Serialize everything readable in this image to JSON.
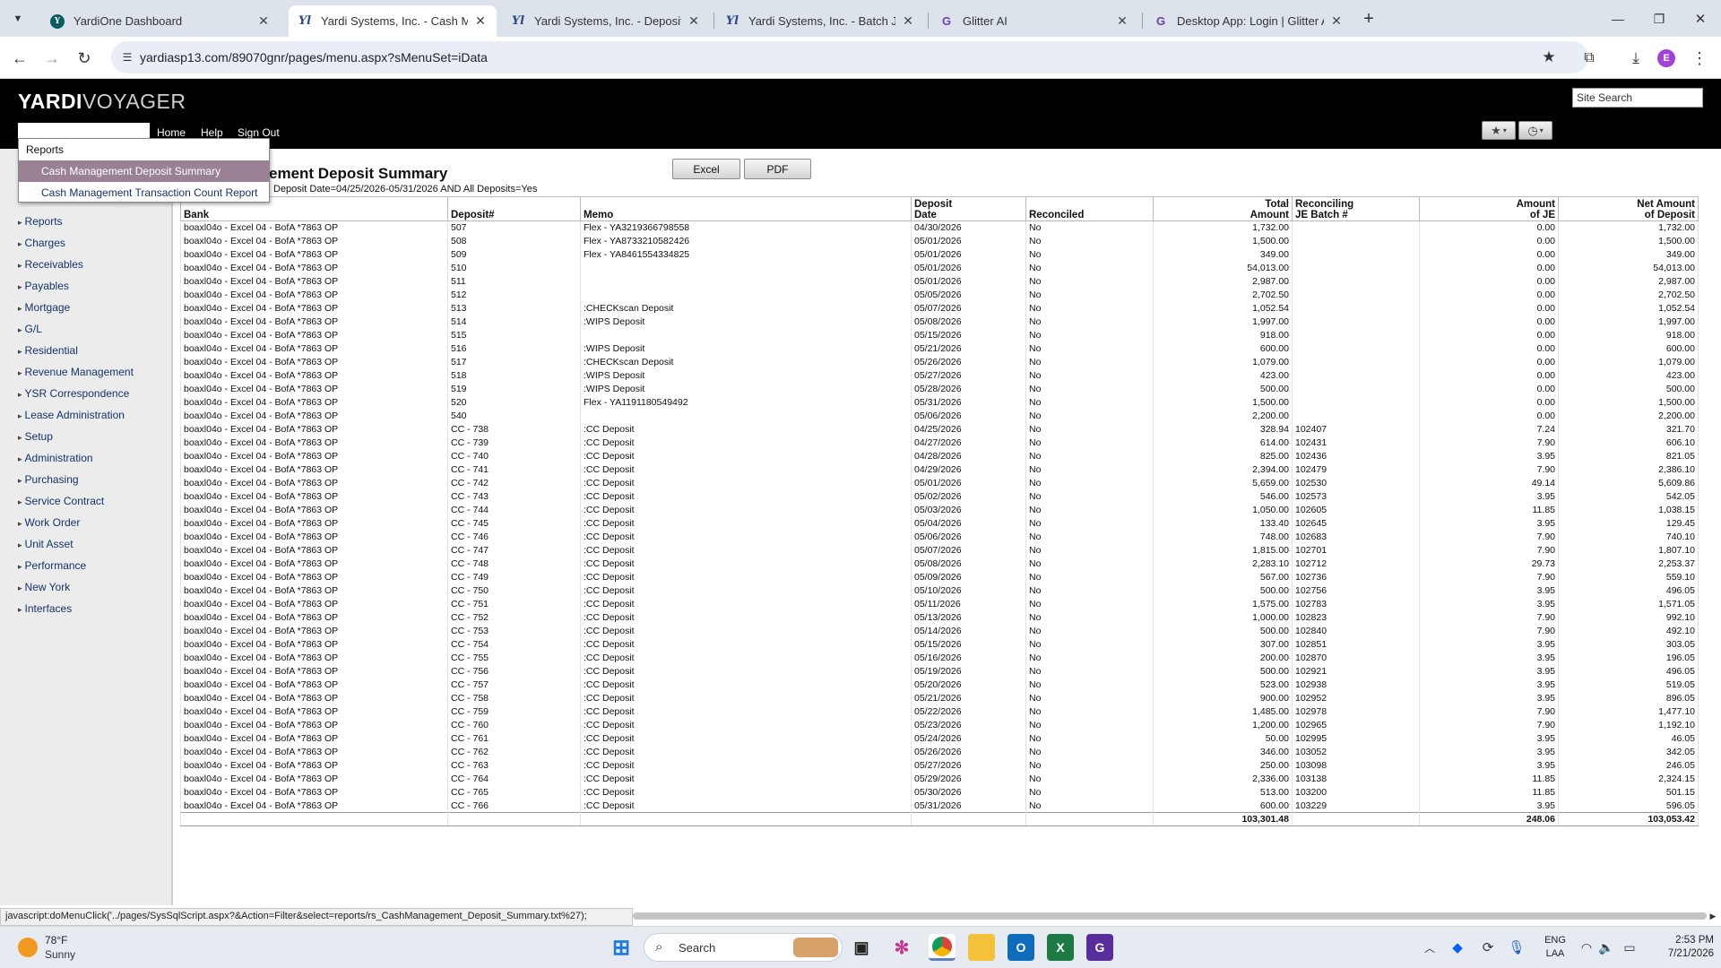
{
  "browser": {
    "tabs": [
      {
        "title": "YardiOne Dashboard",
        "favicon": "yardione-icon"
      },
      {
        "title": "Yardi Systems, Inc. - Cash Mana",
        "favicon": "yardi-icon",
        "active": true
      },
      {
        "title": "Yardi Systems, Inc. - Deposit Re",
        "favicon": "yardi-icon"
      },
      {
        "title": "Yardi Systems, Inc. - Batch Journ",
        "favicon": "yardi-icon"
      },
      {
        "title": "Glitter AI",
        "favicon": "glitter-icon"
      },
      {
        "title": "Desktop App: Login | Glitter AI",
        "favicon": "glitter-icon"
      }
    ],
    "url": "yardiasp13.com/89070gnr/pages/menu.aspx?sMenuSet=iData",
    "profile_initial": "E",
    "profile_color": "#a142d6"
  },
  "app": {
    "logo_bold": "YARDI",
    "logo_light": "VOYAGER",
    "site_search_placeholder": "Site Search",
    "top_nav": [
      "Home",
      "Help",
      "Sign Out"
    ]
  },
  "dropdown": {
    "header": "Reports",
    "items": [
      "Cash Management Deposit Summary",
      "Cash Management Transaction Count Report"
    ],
    "selected_index": 0
  },
  "left_nav": [
    "Reports",
    "Charges",
    "Receivables",
    "Payables",
    "Mortgage",
    "G/L",
    "Residential",
    "Revenue Management",
    "YSR Correspondence",
    "Lease Administration",
    "Setup",
    "Administration",
    "Purchasing",
    "Service Contract",
    "Work Order",
    "Unit Asset",
    "Performance",
    "New York",
    "Interfaces"
  ],
  "report": {
    "title": "ement Deposit Summary",
    "filter": "Deposit Date=04/25/2026-05/31/2026 AND All Deposits=Yes",
    "excel_label": "Excel",
    "pdf_label": "PDF",
    "columns": [
      "Bank",
      "Deposit#",
      "Memo",
      "Deposit Date",
      "Reconciled",
      "Total Amount",
      "Reconciling JE Batch #",
      "Amount of JE",
      "Net Amount of Deposit"
    ],
    "rows": [
      [
        "boaxl04o - Excel 04 - BofA *7863 OP",
        "507",
        "Flex - YA3219366798558",
        "04/30/2026",
        "No",
        "1,732.00",
        "",
        "0.00",
        "1,732.00"
      ],
      [
        "boaxl04o - Excel 04 - BofA *7863 OP",
        "508",
        "Flex - YA8733210582426",
        "05/01/2026",
        "No",
        "1,500.00",
        "",
        "0.00",
        "1,500.00"
      ],
      [
        "boaxl04o - Excel 04 - BofA *7863 OP",
        "509",
        "Flex - YA8461554334825",
        "05/01/2026",
        "No",
        "349.00",
        "",
        "0.00",
        "349.00"
      ],
      [
        "boaxl04o - Excel 04 - BofA *7863 OP",
        "510",
        "",
        "05/01/2026",
        "No",
        "54,013.00",
        "",
        "0.00",
        "54,013.00"
      ],
      [
        "boaxl04o - Excel 04 - BofA *7863 OP",
        "511",
        "",
        "05/01/2026",
        "No",
        "2,987.00",
        "",
        "0.00",
        "2,987.00"
      ],
      [
        "boaxl04o - Excel 04 - BofA *7863 OP",
        "512",
        "",
        "05/05/2026",
        "No",
        "2,702.50",
        "",
        "0.00",
        "2,702.50"
      ],
      [
        "boaxl04o - Excel 04 - BofA *7863 OP",
        "513",
        ":CHECKscan Deposit",
        "05/07/2026",
        "No",
        "1,052.54",
        "",
        "0.00",
        "1,052.54"
      ],
      [
        "boaxl04o - Excel 04 - BofA *7863 OP",
        "514",
        ":WIPS Deposit",
        "05/08/2026",
        "No",
        "1,997.00",
        "",
        "0.00",
        "1,997.00"
      ],
      [
        "boaxl04o - Excel 04 - BofA *7863 OP",
        "515",
        "",
        "05/15/2026",
        "No",
        "918.00",
        "",
        "0.00",
        "918.00"
      ],
      [
        "boaxl04o - Excel 04 - BofA *7863 OP",
        "516",
        ":WIPS Deposit",
        "05/21/2026",
        "No",
        "600.00",
        "",
        "0.00",
        "600.00"
      ],
      [
        "boaxl04o - Excel 04 - BofA *7863 OP",
        "517",
        ":CHECKscan Deposit",
        "05/26/2026",
        "No",
        "1,079.00",
        "",
        "0.00",
        "1,079.00"
      ],
      [
        "boaxl04o - Excel 04 - BofA *7863 OP",
        "518",
        ":WIPS Deposit",
        "05/27/2026",
        "No",
        "423.00",
        "",
        "0.00",
        "423.00"
      ],
      [
        "boaxl04o - Excel 04 - BofA *7863 OP",
        "519",
        ":WIPS Deposit",
        "05/28/2026",
        "No",
        "500.00",
        "",
        "0.00",
        "500.00"
      ],
      [
        "boaxl04o - Excel 04 - BofA *7863 OP",
        "520",
        "Flex - YA1191180549492",
        "05/31/2026",
        "No",
        "1,500.00",
        "",
        "0.00",
        "1,500.00"
      ],
      [
        "boaxl04o - Excel 04 - BofA *7863 OP",
        "540",
        "",
        "05/06/2026",
        "No",
        "2,200.00",
        "",
        "0.00",
        "2,200.00"
      ],
      [
        "boaxl04o - Excel 04 - BofA *7863 OP",
        "CC - 738",
        ":CC Deposit",
        "04/25/2026",
        "No",
        "328.94",
        "102407",
        "7.24",
        "321.70"
      ],
      [
        "boaxl04o - Excel 04 - BofA *7863 OP",
        "CC - 739",
        ":CC Deposit",
        "04/27/2026",
        "No",
        "614.00",
        "102431",
        "7.90",
        "606.10"
      ],
      [
        "boaxl04o - Excel 04 - BofA *7863 OP",
        "CC - 740",
        ":CC Deposit",
        "04/28/2026",
        "No",
        "825.00",
        "102436",
        "3.95",
        "821.05"
      ],
      [
        "boaxl04o - Excel 04 - BofA *7863 OP",
        "CC - 741",
        ":CC Deposit",
        "04/29/2026",
        "No",
        "2,394.00",
        "102479",
        "7.90",
        "2,386.10"
      ],
      [
        "boaxl04o - Excel 04 - BofA *7863 OP",
        "CC - 742",
        ":CC Deposit",
        "05/01/2026",
        "No",
        "5,659.00",
        "102530",
        "49.14",
        "5,609.86"
      ],
      [
        "boaxl04o - Excel 04 - BofA *7863 OP",
        "CC - 743",
        ":CC Deposit",
        "05/02/2026",
        "No",
        "546.00",
        "102573",
        "3.95",
        "542.05"
      ],
      [
        "boaxl04o - Excel 04 - BofA *7863 OP",
        "CC - 744",
        ":CC Deposit",
        "05/03/2026",
        "No",
        "1,050.00",
        "102605",
        "11.85",
        "1,038.15"
      ],
      [
        "boaxl04o - Excel 04 - BofA *7863 OP",
        "CC - 745",
        ":CC Deposit",
        "05/04/2026",
        "No",
        "133.40",
        "102645",
        "3.95",
        "129.45"
      ],
      [
        "boaxl04o - Excel 04 - BofA *7863 OP",
        "CC - 746",
        ":CC Deposit",
        "05/06/2026",
        "No",
        "748.00",
        "102683",
        "7.90",
        "740.10"
      ],
      [
        "boaxl04o - Excel 04 - BofA *7863 OP",
        "CC - 747",
        ":CC Deposit",
        "05/07/2026",
        "No",
        "1,815.00",
        "102701",
        "7.90",
        "1,807.10"
      ],
      [
        "boaxl04o - Excel 04 - BofA *7863 OP",
        "CC - 748",
        ":CC Deposit",
        "05/08/2026",
        "No",
        "2,283.10",
        "102712",
        "29.73",
        "2,253.37"
      ],
      [
        "boaxl04o - Excel 04 - BofA *7863 OP",
        "CC - 749",
        ":CC Deposit",
        "05/09/2026",
        "No",
        "567.00",
        "102736",
        "7.90",
        "559.10"
      ],
      [
        "boaxl04o - Excel 04 - BofA *7863 OP",
        "CC - 750",
        ":CC Deposit",
        "05/10/2026",
        "No",
        "500.00",
        "102756",
        "3.95",
        "496.05"
      ],
      [
        "boaxl04o - Excel 04 - BofA *7863 OP",
        "CC - 751",
        ":CC Deposit",
        "05/11/2026",
        "No",
        "1,575.00",
        "102783",
        "3.95",
        "1,571.05"
      ],
      [
        "boaxl04o - Excel 04 - BofA *7863 OP",
        "CC - 752",
        ":CC Deposit",
        "05/13/2026",
        "No",
        "1,000.00",
        "102823",
        "7.90",
        "992.10"
      ],
      [
        "boaxl04o - Excel 04 - BofA *7863 OP",
        "CC - 753",
        ":CC Deposit",
        "05/14/2026",
        "No",
        "500.00",
        "102840",
        "7.90",
        "492.10"
      ],
      [
        "boaxl04o - Excel 04 - BofA *7863 OP",
        "CC - 754",
        ":CC Deposit",
        "05/15/2026",
        "No",
        "307.00",
        "102851",
        "3.95",
        "303.05"
      ],
      [
        "boaxl04o - Excel 04 - BofA *7863 OP",
        "CC - 755",
        ":CC Deposit",
        "05/16/2026",
        "No",
        "200.00",
        "102870",
        "3.95",
        "196.05"
      ],
      [
        "boaxl04o - Excel 04 - BofA *7863 OP",
        "CC - 756",
        ":CC Deposit",
        "05/19/2026",
        "No",
        "500.00",
        "102921",
        "3.95",
        "496.05"
      ],
      [
        "boaxl04o - Excel 04 - BofA *7863 OP",
        "CC - 757",
        ":CC Deposit",
        "05/20/2026",
        "No",
        "523.00",
        "102938",
        "3.95",
        "519.05"
      ],
      [
        "boaxl04o - Excel 04 - BofA *7863 OP",
        "CC - 758",
        ":CC Deposit",
        "05/21/2026",
        "No",
        "900.00",
        "102952",
        "3.95",
        "896.05"
      ],
      [
        "boaxl04o - Excel 04 - BofA *7863 OP",
        "CC - 759",
        ":CC Deposit",
        "05/22/2026",
        "No",
        "1,485.00",
        "102978",
        "7.90",
        "1,477.10"
      ],
      [
        "boaxl04o - Excel 04 - BofA *7863 OP",
        "CC - 760",
        ":CC Deposit",
        "05/23/2026",
        "No",
        "1,200.00",
        "102965",
        "7.90",
        "1,192.10"
      ],
      [
        "boaxl04o - Excel 04 - BofA *7863 OP",
        "CC - 761",
        ":CC Deposit",
        "05/24/2026",
        "No",
        "50.00",
        "102995",
        "3.95",
        "46.05"
      ],
      [
        "boaxl04o - Excel 04 - BofA *7863 OP",
        "CC - 762",
        ":CC Deposit",
        "05/26/2026",
        "No",
        "346.00",
        "103052",
        "3.95",
        "342.05"
      ],
      [
        "boaxl04o - Excel 04 - BofA *7863 OP",
        "CC - 763",
        ":CC Deposit",
        "05/27/2026",
        "No",
        "250.00",
        "103098",
        "3.95",
        "246.05"
      ],
      [
        "boaxl04o - Excel 04 - BofA *7863 OP",
        "CC - 764",
        ":CC Deposit",
        "05/29/2026",
        "No",
        "2,336.00",
        "103138",
        "11.85",
        "2,324.15"
      ],
      [
        "boaxl04o - Excel 04 - BofA *7863 OP",
        "CC - 765",
        ":CC Deposit",
        "05/30/2026",
        "No",
        "513.00",
        "103200",
        "11.85",
        "501.15"
      ],
      [
        "boaxl04o - Excel 04 - BofA *7863 OP",
        "CC - 766",
        ":CC Deposit",
        "05/31/2026",
        "No",
        "600.00",
        "103229",
        "3.95",
        "596.05"
      ]
    ],
    "totals": [
      "",
      "",
      "",
      "",
      "",
      "103,301.48",
      "",
      "248.06",
      "103,053.42"
    ]
  },
  "status_url": "javascript:doMenuClick('../pages/SysSqlScript.aspx?&Action=Filter&select=reports/rs_CashManagement_Deposit_Summary.txt%27);",
  "taskbar": {
    "weather_temp": "78°F",
    "weather_desc": "Sunny",
    "search_label": "Search",
    "lang_top": "ENG",
    "lang_bottom": "LAA",
    "time": "2:53 PM",
    "date": "7/21/2026"
  }
}
